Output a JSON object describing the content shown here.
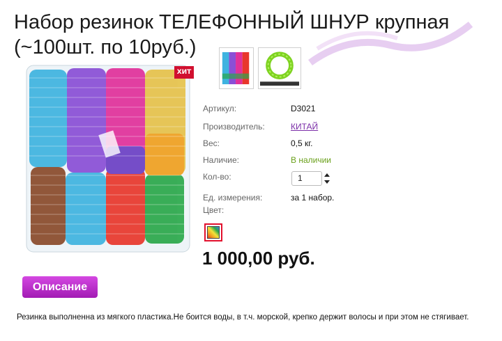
{
  "product": {
    "title": "Набор резинок ТЕЛЕФОННЫЙ ШНУР крупная (~100шт. по 10руб.)",
    "badge": "ХИТ",
    "images": {
      "main": "product-photo",
      "thumbnails": [
        "thumbnail-photo-assorted",
        "thumbnail-photo-green-ring"
      ]
    }
  },
  "specs": [
    {
      "label": "Артикул:",
      "value": "D3021"
    },
    {
      "label": "Производитель:",
      "value": "КИТАЙ"
    },
    {
      "label": "Вес:",
      "value": "0,5 кг."
    },
    {
      "label": "Наличие:",
      "value": "В наличии"
    },
    {
      "label": "Кол-во:",
      "value": ""
    },
    {
      "label": "Ед. измерения:",
      "value": "за 1 набор."
    },
    {
      "label": "Цвет:",
      "value": ""
    }
  ],
  "quantity": {
    "value": "1"
  },
  "color_swatch": {
    "name": "rainbow-swatch"
  },
  "price": "1 000,00 руб.",
  "tabs": {
    "description_label": "Описание"
  },
  "description": "Резинка выполненна из мягкого пластика.Не боится воды, в т.ч. морской, крепко держит волосы и при этом не стягивает.",
  "colors": {
    "accent": "#b82ec8",
    "link": "#7b2ea8",
    "in_stock": "#6aa01b",
    "badge": "#d10f2f"
  }
}
